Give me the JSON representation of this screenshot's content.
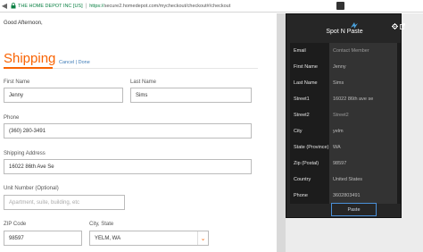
{
  "browser": {
    "secure_label": "THE HOME DEPOT INC [US]",
    "url_scheme": "https://",
    "url_rest": "secure2.homedepot.com/mycheckout/checkout#/checkout",
    "back_icon": "back-arrow-icon",
    "forward_icon": "forward-arrow-icon",
    "lock_icon": "lock-icon"
  },
  "page": {
    "greeting": "Good Afternoon,",
    "section_title": "Shipping",
    "cancel_label": "Cancel",
    "done_label": "Done",
    "link_separator": "|",
    "accent_color": "#f96302"
  },
  "form": {
    "first_name": {
      "label": "First Name",
      "value": "Jenny"
    },
    "last_name": {
      "label": "Last Name",
      "value": "Sims"
    },
    "phone": {
      "label": "Phone",
      "value": "(360) 280-3491"
    },
    "shipping_address": {
      "label": "Shipping Address",
      "value": "16022 86th Ave Se"
    },
    "unit_number": {
      "label": "Unit Number (Optional)",
      "placeholder": "Apartment, suite, building, etc"
    },
    "zip_code": {
      "label": "ZIP Code",
      "value": "98597"
    },
    "city_state": {
      "label": "City, State",
      "value": "YELM, WA"
    }
  },
  "popup": {
    "title": "Spot N Paste",
    "paste_label": "Paste",
    "rows": [
      {
        "label": "Email",
        "value": "Contact Member",
        "filled": false
      },
      {
        "label": "First Name",
        "value": "Jenny",
        "filled": true
      },
      {
        "label": "Last Name",
        "value": "Sims",
        "filled": true
      },
      {
        "label": "Street1",
        "value": "16022 86th ave se",
        "filled": true
      },
      {
        "label": "Street2",
        "value": "Street2",
        "filled": false
      },
      {
        "label": "City",
        "value": "yelm",
        "filled": true
      },
      {
        "label": "State (Province)",
        "value": "WA",
        "filled": true
      },
      {
        "label": "Zip (Postal)",
        "value": "98597",
        "filled": true
      },
      {
        "label": "Country",
        "value": "United States",
        "filled": true
      },
      {
        "label": "Phone",
        "value": "3602803491",
        "filled": true
      }
    ]
  }
}
